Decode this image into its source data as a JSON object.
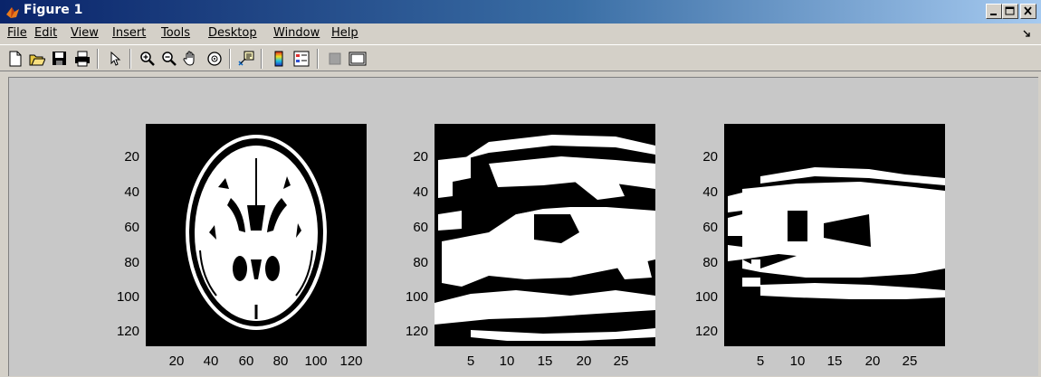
{
  "window": {
    "title": "Figure 1"
  },
  "menu": [
    "File",
    "Edit",
    "View",
    "Insert",
    "Tools",
    "Desktop",
    "Window",
    "Help"
  ],
  "toolbar_icons": [
    "new-figure-icon",
    "open-file-icon",
    "save-icon",
    "print-icon",
    "select-arrow-icon",
    "zoom-in-icon",
    "zoom-out-icon",
    "pan-hand-icon",
    "rotate-3d-icon",
    "data-cursor-icon",
    "colorbar-icon",
    "legend-icon",
    "hide-plot-tools-icon",
    "show-plot-tools-icon"
  ],
  "plots": [
    {
      "yticks": [
        "20",
        "40",
        "60",
        "80",
        "100",
        "120"
      ],
      "xticks": [
        "20",
        "40",
        "60",
        "80",
        "100",
        "120"
      ]
    },
    {
      "yticks": [
        "20",
        "40",
        "60",
        "80",
        "100",
        "120"
      ],
      "xticks": [
        "5",
        "10",
        "15",
        "20",
        "25"
      ]
    },
    {
      "yticks": [
        "20",
        "40",
        "60",
        "80",
        "100",
        "120"
      ],
      "xticks": [
        "5",
        "10",
        "15",
        "20",
        "25"
      ]
    }
  ],
  "colors": {
    "background": "#000000",
    "foreground": "#ffffff"
  }
}
